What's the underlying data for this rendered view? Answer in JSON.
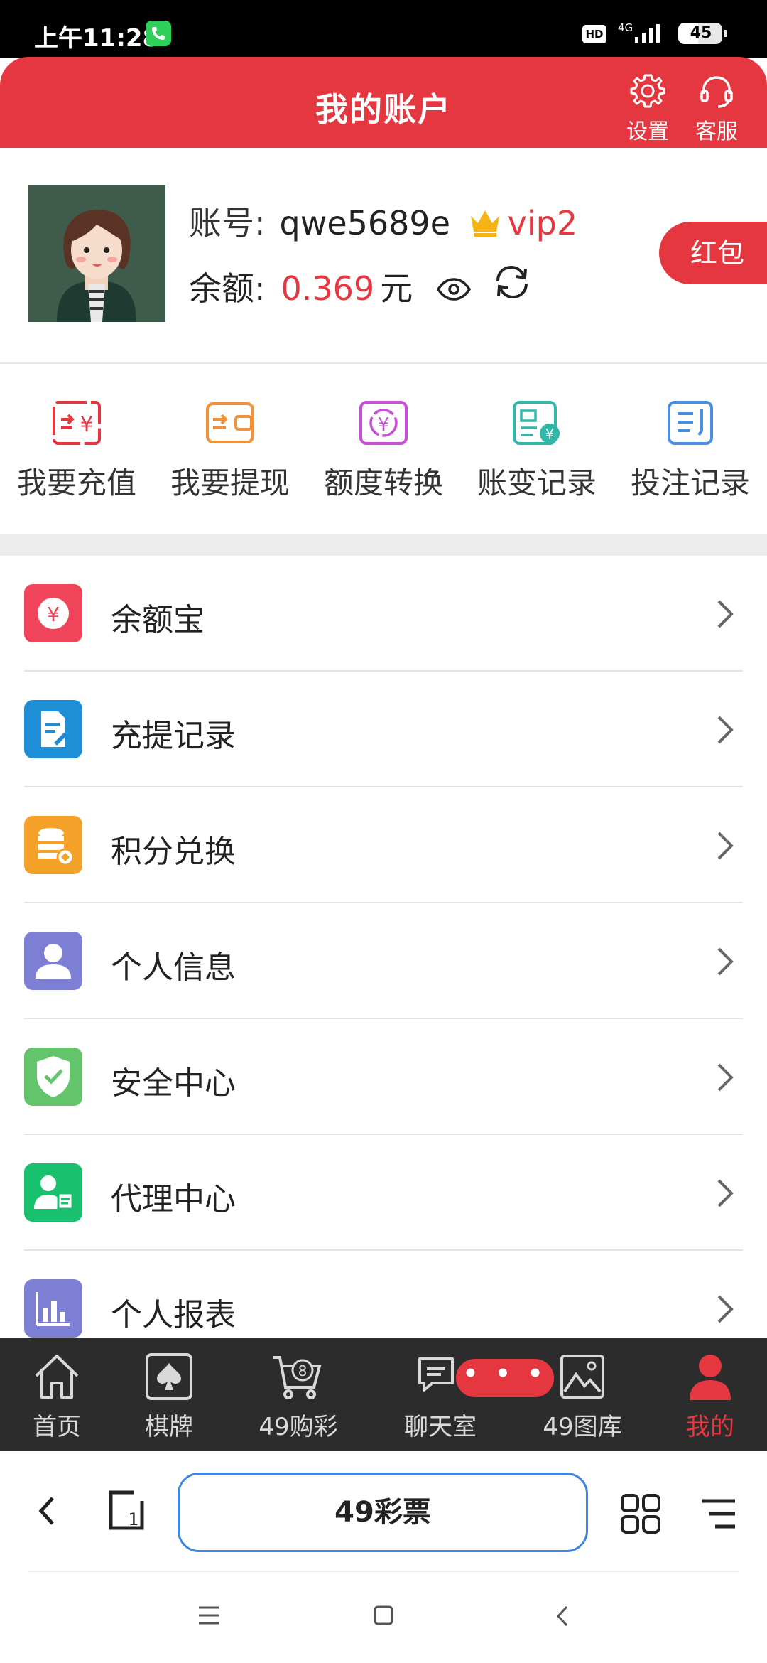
{
  "status_bar": {
    "time": "上午11:28",
    "hd": "HD",
    "network": "4G",
    "battery": "45",
    "battery_level": 0.45
  },
  "header": {
    "title": "我的账户",
    "settings_label": "设置",
    "service_label": "客服",
    "color": "#e5373f"
  },
  "profile": {
    "account_key": "账号:",
    "account_value": "qwe5689e",
    "vip": "vip2",
    "balance_key": "余额:",
    "balance_value": "0.369",
    "balance_unit": "元",
    "red_packet": "红包"
  },
  "actions": [
    {
      "label": "我要充值",
      "icon": "recharge-icon",
      "color": "#e5373f"
    },
    {
      "label": "我要提现",
      "icon": "withdraw-icon",
      "color": "#f0923a"
    },
    {
      "label": "额度转换",
      "icon": "transfer-icon",
      "color": "#c94fd8"
    },
    {
      "label": "账变记录",
      "icon": "account-change-icon",
      "color": "#2fb8a8"
    },
    {
      "label": "投注记录",
      "icon": "bet-record-icon",
      "color": "#4a90e2"
    }
  ],
  "menu": [
    {
      "label": "余额宝",
      "icon": "yuebao-icon",
      "color": "#f0445a"
    },
    {
      "label": "充提记录",
      "icon": "record-icon",
      "color": "#1e8fd6"
    },
    {
      "label": "积分兑换",
      "icon": "points-icon",
      "color": "#f4a12a"
    },
    {
      "label": "个人信息",
      "icon": "user-icon",
      "color": "#7c7fd4"
    },
    {
      "label": "安全中心",
      "icon": "shield-icon",
      "color": "#63c46b"
    },
    {
      "label": "代理中心",
      "icon": "agent-icon",
      "color": "#19c06d"
    },
    {
      "label": "个人报表",
      "icon": "report-icon",
      "color": "#7c7fd4"
    }
  ],
  "tabbar": [
    {
      "label": "首页",
      "icon": "home-icon"
    },
    {
      "label": "棋牌",
      "icon": "cards-icon"
    },
    {
      "label": "49购彩",
      "icon": "lottery-cart-icon"
    },
    {
      "label": "聊天室",
      "icon": "chat-icon"
    },
    {
      "label": "49图库",
      "icon": "gallery-icon"
    },
    {
      "label": "我的",
      "icon": "profile-icon",
      "active": true
    }
  ],
  "more_pill": "• • •",
  "browser": {
    "url_text": "49彩票",
    "tab_count": "1"
  }
}
